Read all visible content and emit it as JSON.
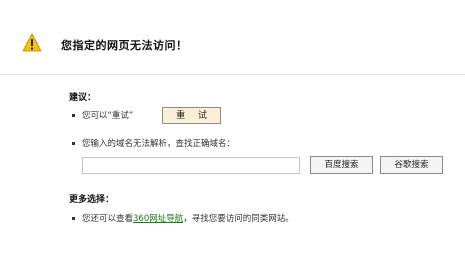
{
  "header": {
    "icon": "warning-icon",
    "title": "您指定的网页无法访问！"
  },
  "suggestions": {
    "heading": "建议：",
    "retry_text": "您可以“重试”",
    "retry_button": "重 试",
    "check_text": "您输入的域名无法解析，查找正确域名：",
    "domain_input_value": "",
    "baidu_button": "百度搜索",
    "google_button": "谷歌搜索"
  },
  "more": {
    "heading": "更多选择：",
    "text_before": "您还可以查看",
    "link_text": "360网址导航",
    "text_after": "，寻找您要访问的同类网站。"
  },
  "colors": {
    "warning_yellow": "#f5c400",
    "link_green": "#1a7a1a",
    "retry_bg": "#fbefd8"
  }
}
